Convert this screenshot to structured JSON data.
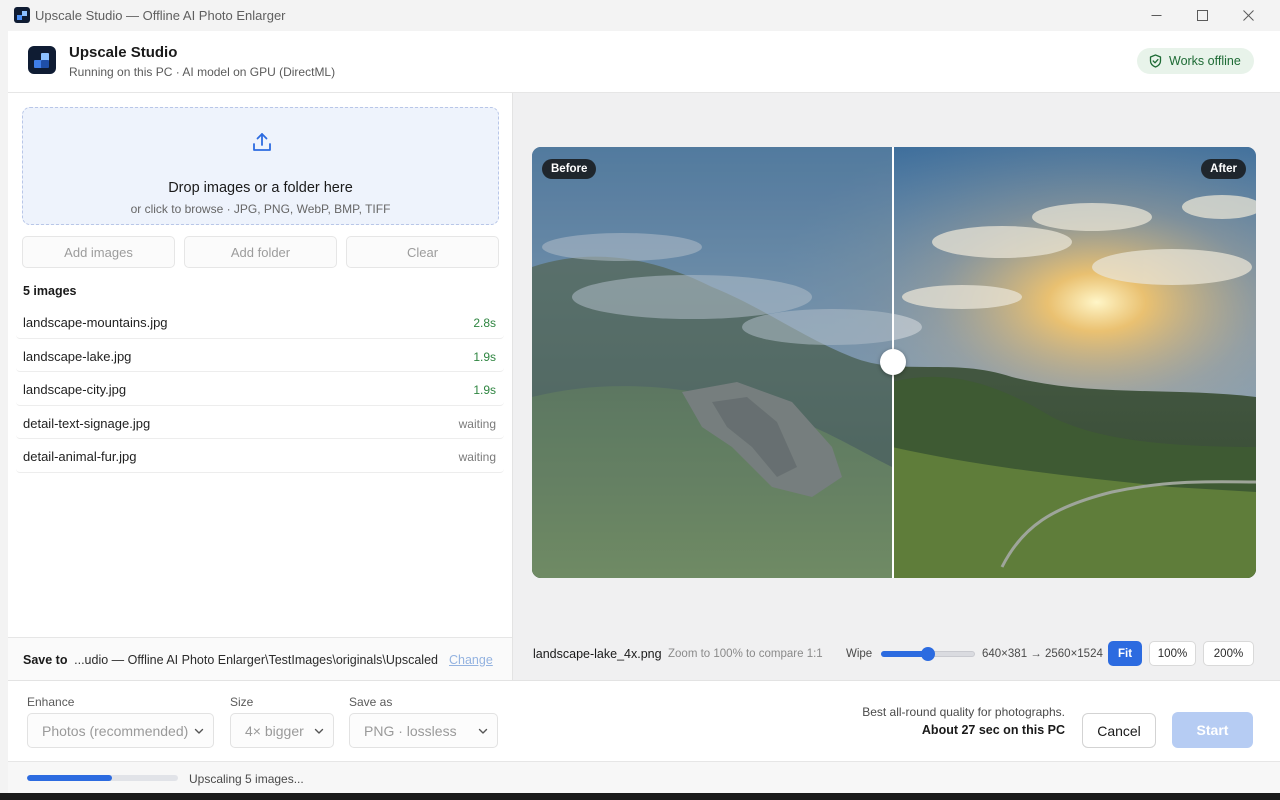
{
  "window": {
    "title": "Upscale Studio — Offline AI Photo Enlarger"
  },
  "header": {
    "app_name": "Upscale Studio",
    "subtitle": "Running on this PC · AI model on GPU (DirectML)",
    "badge": "Works offline"
  },
  "dropzone": {
    "title": "Drop images or a folder here",
    "subtitle": "or click to browse · JPG, PNG, WebP, BMP, TIFF"
  },
  "actions": {
    "add_images": "Add images",
    "add_folder": "Add folder",
    "clear": "Clear"
  },
  "list": {
    "count_label": "5 images",
    "files": [
      {
        "name": "landscape-mountains.jpg",
        "status": "2.8s",
        "done": true
      },
      {
        "name": "landscape-lake.jpg",
        "status": "1.9s",
        "done": true
      },
      {
        "name": "landscape-city.jpg",
        "status": "1.9s",
        "done": true
      },
      {
        "name": "detail-text-signage.jpg",
        "status": "waiting",
        "done": false
      },
      {
        "name": "detail-animal-fur.jpg",
        "status": "waiting",
        "done": false
      }
    ]
  },
  "save": {
    "label": "Save to",
    "path": "...udio — Offline AI Photo Enlarger\\TestImages\\originals\\Upscaled",
    "change": "Change"
  },
  "preview": {
    "before_tag": "Before",
    "after_tag": "After",
    "wipe_position": 0.5,
    "filename": "landscape-lake_4x.png",
    "hint": "Zoom to 100% to compare 1:1",
    "wipe_label": "Wipe",
    "wipe_value": 0.5,
    "resolution": "640×381 → 2560×1524",
    "zoom_fit": "Fit",
    "zoom_100": "100%",
    "zoom_200": "200%"
  },
  "settings": {
    "enhance_label": "Enhance",
    "enhance_value": "Photos (recommended)",
    "size_label": "Size",
    "size_value": "4× bigger",
    "format_label": "Save as",
    "format_value": "PNG · lossless"
  },
  "summary": {
    "line1": "Best all-round quality for photographs.",
    "line2": "About 27 sec on this PC"
  },
  "buttons": {
    "cancel": "Cancel",
    "start": "Start"
  },
  "status": {
    "progress": 0.56,
    "text": "Upscaling 5 images..."
  },
  "colors": {
    "accent": "#2c6be0",
    "success": "#2e8540",
    "offline_badge_bg": "#e8f3ea",
    "start_disabled": "#b6ccf3"
  },
  "icons": {
    "upload": "upload-icon",
    "shield": "shield-check-icon",
    "minimize": "minimize-icon",
    "maximize": "maximize-icon",
    "close": "close-icon",
    "chevron": "chevron-down-icon"
  }
}
